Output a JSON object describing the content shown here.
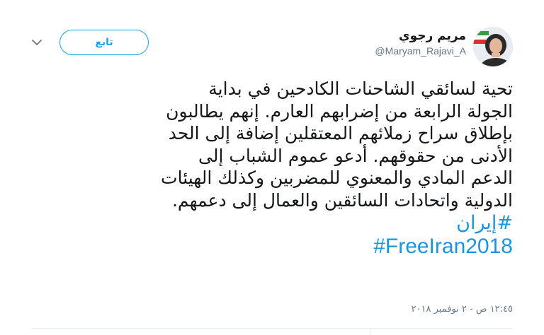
{
  "user": {
    "display_name": "مريم رجوي",
    "handle": "@Maryam_Rajavi_A",
    "avatar_icon": "profile-photo-icon"
  },
  "actions": {
    "follow_label": "تابع",
    "more_icon": "chevron-down-icon"
  },
  "tweet": {
    "text": "تحية لسائقي الشاحنات الكادحين في بداية\nالجولة الرابعة من إضرابهم العارم. إنهم يطالبون\nبإطلاق سراح زملائهم المعتقلين إضافة إلى الحد\nالأدنى من حقوقهم. أدعو عموم الشباب إلى\nالدعم المادي والمعنوي للمضربين وكذلك الهيئات\nالدولية واتحادات السائقين والعمال إلى دعمهم.",
    "hashtags": [
      "#إيران",
      "#FreeIran2018"
    ],
    "timestamp": "١٢:٤٥ ص - ٢ نوفمبر ٢٠١٨"
  },
  "colors": {
    "link": "#1b95e0",
    "follow_border": "#1da1f2",
    "text": "#14171a",
    "secondary": "#657786"
  }
}
